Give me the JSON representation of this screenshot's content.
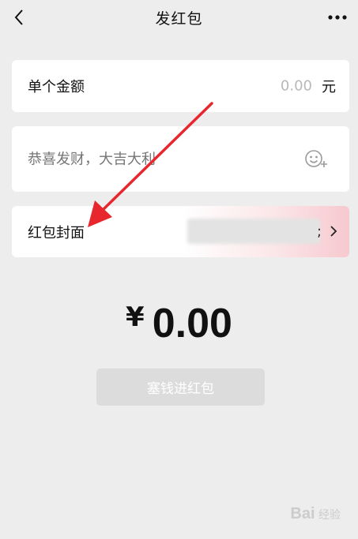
{
  "header": {
    "title": "发红包",
    "back_icon": "chevron-left-icon",
    "more_icon": "more-horizontal-icon"
  },
  "amount_card": {
    "label": "单个金额",
    "value": "0.00",
    "unit": "元"
  },
  "greeting_card": {
    "placeholder": "恭喜发财，大吉大利",
    "emoji_icon": "emoji-add-icon"
  },
  "cover_card": {
    "label": "红包封面",
    "semicolon": ";",
    "chevron_icon": "chevron-right-icon"
  },
  "total": {
    "currency": "¥",
    "amount": "0.00"
  },
  "submit_button": {
    "label": "塞钱进红包"
  },
  "watermark": {
    "logo": "Bai",
    "text": "经验"
  },
  "colors": {
    "background": "#ededed",
    "card": "#ffffff",
    "annotation_arrow": "#e8262e",
    "disabled_button": "#dcdcdc"
  }
}
